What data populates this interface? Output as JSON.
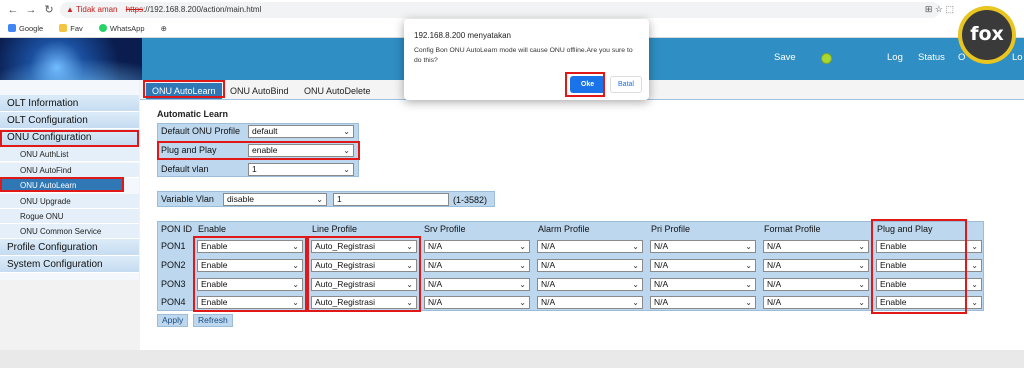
{
  "browser": {
    "security_label": "Tidak aman",
    "url_scheme": "https",
    "url_rest": "://192.168.8.200/action/main.html",
    "bookmarks": [
      "Google",
      "Fav",
      "WhatsApp"
    ]
  },
  "header": {
    "nav": [
      "Save",
      "Log",
      "Status",
      "O",
      "Lo"
    ],
    "save_indicator_color": "#a8d832"
  },
  "logo": {
    "text": "fox"
  },
  "sidebar": {
    "items": [
      {
        "label": "OLT Information"
      },
      {
        "label": "OLT Configuration"
      },
      {
        "label": "ONU Configuration"
      },
      {
        "label": "ONU AuthList"
      },
      {
        "label": "ONU AutoFind"
      },
      {
        "label": "ONU AutoLearn"
      },
      {
        "label": "ONU Upgrade"
      },
      {
        "label": "Rogue ONU"
      },
      {
        "label": "ONU Common Service"
      },
      {
        "label": "Profile Configuration"
      },
      {
        "label": "System Configuration"
      }
    ]
  },
  "tabs": [
    {
      "label": "ONU AutoLearn",
      "active": true
    },
    {
      "label": "ONU AutoBind",
      "active": false
    },
    {
      "label": "ONU AutoDelete",
      "active": false
    }
  ],
  "section_title": "Automatic Learn",
  "form": {
    "default_profile_label": "Default ONU Profile",
    "default_profile_value": "default",
    "plug_play_label": "Plug and Play",
    "plug_play_value": "enable",
    "default_vlan_label": "Default vlan",
    "default_vlan_value": "1",
    "variable_vlan_label": "Variable Vlan",
    "variable_vlan_value": "disable",
    "vlan_input_value": "1",
    "vlan_range": "(1-3582)"
  },
  "table": {
    "headers": [
      "PON ID",
      "Enable",
      "Line Profile",
      "Srv Profile",
      "Alarm Profile",
      "Pri Profile",
      "Format Profile",
      "Plug and Play"
    ],
    "rows": [
      {
        "pon": "PON1",
        "enable": "Enable",
        "line": "Auto_Registrasi",
        "srv": "N/A",
        "alarm": "N/A",
        "pri": "N/A",
        "format": "N/A",
        "pnp": "Enable"
      },
      {
        "pon": "PON2",
        "enable": "Enable",
        "line": "Auto_Registrasi",
        "srv": "N/A",
        "alarm": "N/A",
        "pri": "N/A",
        "format": "N/A",
        "pnp": "Enable"
      },
      {
        "pon": "PON3",
        "enable": "Enable",
        "line": "Auto_Registrasi",
        "srv": "N/A",
        "alarm": "N/A",
        "pri": "N/A",
        "format": "N/A",
        "pnp": "Enable"
      },
      {
        "pon": "PON4",
        "enable": "Enable",
        "line": "Auto_Registrasi",
        "srv": "N/A",
        "alarm": "N/A",
        "pri": "N/A",
        "format": "N/A",
        "pnp": "Enable"
      }
    ]
  },
  "buttons": {
    "apply": "Apply",
    "refresh": "Refresh"
  },
  "dialog": {
    "title": "192.168.8.200 menyatakan",
    "message": "Config Bon ONU AutoLearn mode will cause ONU offline.Are you sure to do this?",
    "ok": "Oke",
    "cancel": "Batal"
  },
  "colors": {
    "highlight": "#e01818",
    "accent": "#2f77b5",
    "header": "#2f8ec3"
  }
}
